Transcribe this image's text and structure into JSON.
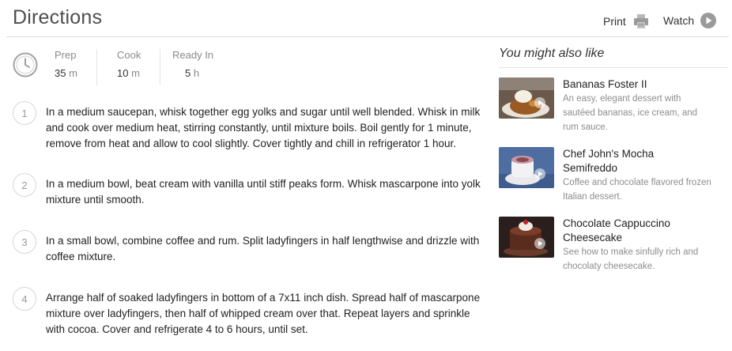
{
  "header": {
    "title": "Directions",
    "print_label": "Print",
    "watch_label": "Watch"
  },
  "times": {
    "prep_label": "Prep",
    "prep_value": "35",
    "prep_unit": "m",
    "cook_label": "Cook",
    "cook_value": "10",
    "cook_unit": "m",
    "ready_label": "Ready In",
    "ready_value": "5",
    "ready_unit": "h"
  },
  "steps": [
    {
      "num": "1",
      "text": "In a medium saucepan, whisk together egg yolks and sugar until well blended. Whisk in milk and cook over medium heat, stirring constantly, until mixture boils. Boil gently for 1 minute, remove from heat and allow to cool slightly. Cover tightly and chill in refrigerator 1 hour."
    },
    {
      "num": "2",
      "text": "In a medium bowl, beat cream with vanilla until stiff peaks form. Whisk mascarpone into yolk mixture until smooth."
    },
    {
      "num": "3",
      "text": "In a small bowl, combine coffee and rum. Split ladyfingers in half lengthwise and drizzle with coffee mixture."
    },
    {
      "num": "4",
      "text": "Arrange half of soaked ladyfingers in bottom of a 7x11 inch dish. Spread half of mascarpone mixture over ladyfingers, then half of whipped cream over that. Repeat layers and sprinkle with cocoa. Cover and refrigerate 4 to 6 hours, until set."
    }
  ],
  "sidebar": {
    "title": "You might also like",
    "cards": [
      {
        "title": "Bananas Foster II",
        "desc": "An easy, elegant dessert with sautéed bananas, ice cream, and rum sauce."
      },
      {
        "title": "Chef John's Mocha Semifreddo",
        "desc": "Coffee and chocolate flavored frozen Italian dessert."
      },
      {
        "title": "Chocolate Cappuccino Cheesecake",
        "desc": "See how to make sinfully rich and chocolaty cheesecake."
      }
    ]
  },
  "colors": {
    "rule": "#dcdcdc",
    "muted_text": "#8d8d8d",
    "icon_gray": "#9a9a9a"
  },
  "icons": [
    "print-icon",
    "play-icon",
    "clock-icon"
  ]
}
